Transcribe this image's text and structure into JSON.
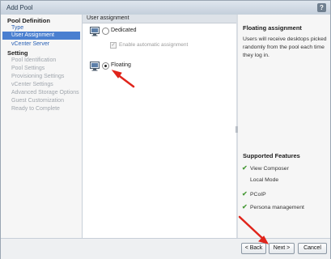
{
  "window": {
    "title": "Add Pool",
    "help_glyph": "?"
  },
  "sidebar": {
    "groups": [
      {
        "title": "Pool Definition"
      },
      {
        "title": "Setting"
      }
    ],
    "items": [
      {
        "label": "Type",
        "state": "done"
      },
      {
        "label": "User Assignment",
        "state": "active"
      },
      {
        "label": "vCenter Server",
        "state": "done"
      },
      {
        "label": "Pool Identification",
        "state": "disabled"
      },
      {
        "label": "Pool Settings",
        "state": "disabled"
      },
      {
        "label": "Provisioning Settings",
        "state": "disabled"
      },
      {
        "label": "vCenter Settings",
        "state": "disabled"
      },
      {
        "label": "Advanced Storage Options",
        "state": "disabled"
      },
      {
        "label": "Guest Customization",
        "state": "disabled"
      },
      {
        "label": "Ready to Complete",
        "state": "disabled"
      }
    ]
  },
  "main": {
    "section_title": "User assignment",
    "options": [
      {
        "label": "Dedicated",
        "selected": false,
        "icon": "desktop-icon"
      },
      {
        "label": "Floating",
        "selected": true,
        "icon": "desktop-icon"
      }
    ],
    "auto_assign": {
      "label": "Enable automatic assignment",
      "checked": true,
      "enabled": false
    }
  },
  "help": {
    "title": "Floating assignment",
    "body": "Users will receive desktops picked randomly from the pool each time they log in.",
    "features_title": "Supported Features",
    "features": [
      {
        "label": "View Composer",
        "supported": true
      },
      {
        "label": "Local Mode",
        "supported": false
      },
      {
        "label": "PCoIP",
        "supported": true
      },
      {
        "label": "Persona management",
        "supported": true
      }
    ]
  },
  "footer": {
    "back_label": "< Back",
    "next_label": "Next >",
    "cancel_label": "Cancel"
  },
  "colors": {
    "accent": "#4a7fd0",
    "annotation_arrow": "#e0241b",
    "check": "#4a9b3a"
  }
}
